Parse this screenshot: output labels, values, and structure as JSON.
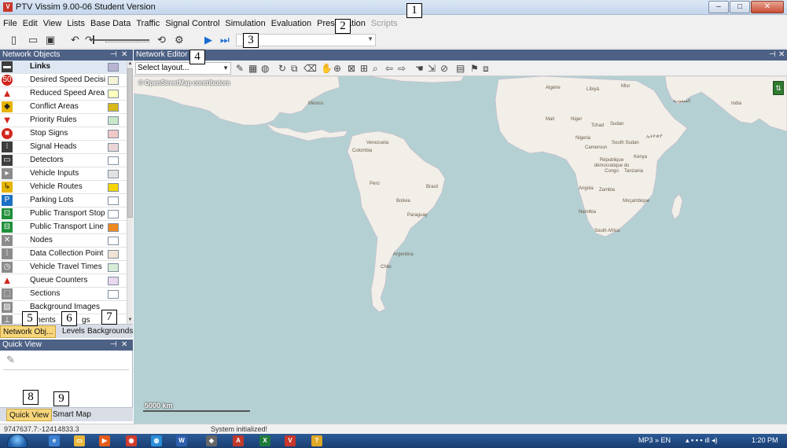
{
  "window": {
    "title": "PTV Vissim 9.00-06 Student Version",
    "app_logo": "V",
    "minimize_icon": "‒",
    "maximize_icon": "□",
    "close_icon": "✕"
  },
  "menu": {
    "items": [
      "File",
      "Edit",
      "View",
      "Lists",
      "Base Data",
      "Traffic",
      "Signal Control",
      "Simulation",
      "Evaluation",
      "Presentation",
      "Scripts"
    ],
    "disabled": [
      "Scripts"
    ]
  },
  "callouts": [
    "1",
    "2",
    "3",
    "4",
    "5",
    "6",
    "7",
    "8",
    "9"
  ],
  "network_objects": {
    "title": "Network Objects",
    "pin_icon": "⊣",
    "close_icon": "✕",
    "items": [
      {
        "label": "Links",
        "icon": "links-icon",
        "swatch": "#b9b3d4"
      },
      {
        "label": "Desired Speed Decisi",
        "icon": "desired-speed-icon",
        "swatch": "#f6f4d6"
      },
      {
        "label": "Reduced Speed Area",
        "icon": "reduced-speed-icon",
        "swatch": "#ffffc0"
      },
      {
        "label": "Conflict Areas",
        "icon": "conflict-areas-icon",
        "swatch": "#d8b81a"
      },
      {
        "label": "Priority Rules",
        "icon": "priority-rules-icon",
        "swatch": "#c7e7c8"
      },
      {
        "label": "Stop Signs",
        "icon": "stop-sign-icon",
        "swatch": "#f1c7c7"
      },
      {
        "label": "Signal Heads",
        "icon": "signal-heads-icon",
        "swatch": "#ead6d6"
      },
      {
        "label": "Detectors",
        "icon": "detectors-icon",
        "swatch": "#ffffff"
      },
      {
        "label": "Vehicle Inputs",
        "icon": "vehicle-inputs-icon",
        "swatch": "#e2e2e2"
      },
      {
        "label": "Vehicle Routes",
        "icon": "vehicle-routes-icon",
        "swatch": "#f5d400"
      },
      {
        "label": "Parking Lots",
        "icon": "parking-lots-icon",
        "swatch": "#ffffff"
      },
      {
        "label": "Public Transport Stop",
        "icon": "pt-stop-icon",
        "swatch": "#ffffff"
      },
      {
        "label": "Public Transport Line",
        "icon": "pt-line-icon",
        "swatch": "#ef8a20"
      },
      {
        "label": "Nodes",
        "icon": "nodes-icon",
        "swatch": "#ffffff"
      },
      {
        "label": "Data Collection Point",
        "icon": "data-collection-icon",
        "swatch": "#efe4d4"
      },
      {
        "label": "Vehicle Travel Times",
        "icon": "travel-times-icon",
        "swatch": "#d6ecd6"
      },
      {
        "label": "Queue Counters",
        "icon": "queue-counters-icon",
        "swatch": "#e9d8ef"
      },
      {
        "label": "Sections",
        "icon": "sections-icon",
        "swatch": "#ffffff"
      },
      {
        "label": "Background Images",
        "icon": "background-images-icon",
        "swatch": ""
      },
      {
        "label": "ements",
        "tail": "gs",
        "icon": "static-elements-icon",
        "swatch": ""
      }
    ],
    "tabs": [
      "Network Obj...",
      "Levels",
      "Backgrounds"
    ]
  },
  "quick_view": {
    "title": "Quick View",
    "pin_icon": "⊣",
    "close_icon": "✕",
    "tool_icon": "✎",
    "tabs": [
      "Quick View",
      "Smart Map"
    ]
  },
  "network_editor": {
    "title": "Network Editor",
    "pin_icon": "⊣",
    "close_icon": "✕",
    "layout_select": "Select layout...",
    "attribution": "© OpenStreetMap contributors",
    "scale": "5000 km",
    "map_labels": {
      "mexico": "México",
      "venezuela": "Venezuela",
      "colombia": "Colombia",
      "peru": "Perú",
      "brasil": "Brasil",
      "bolivia": "Bolivia",
      "paraguay": "Paraguay",
      "chile": "Chile",
      "argentina": "Argentina",
      "mali": "Mali",
      "niger": "Niger",
      "nigeria": "Nigeria",
      "tchad": "Tchad",
      "sudan": "Sudan",
      "south_sudan": "South Sudan",
      "cameroun": "Cameroun",
      "kenya": "Kenya",
      "rdc": "République démocratique du Congo",
      "tanzania": "Tanzania",
      "angola": "Angola",
      "zambia": "Zambia",
      "mocambique": "Moçambique",
      "namibia": "Namibia",
      "south_africa": "South Africa",
      "india": "India",
      "misr": "Misr",
      "libya": "Lībiyā",
      "algeria": "Algérie",
      "ethiopia": "ኢትዮጵያ",
      "saudi": "السعودية"
    }
  },
  "status": {
    "coordinates": "9747637.7:-12414833.3",
    "message": "System initialized!"
  },
  "taskbar": {
    "tray": "MP3  »  EN",
    "time": "1:20 PM"
  }
}
